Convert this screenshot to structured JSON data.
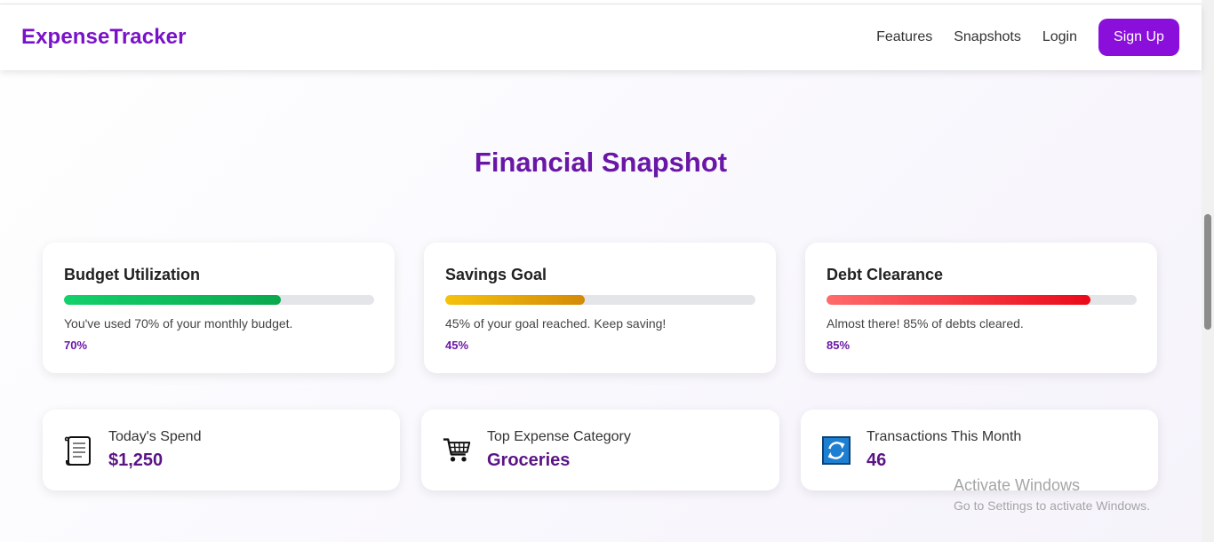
{
  "nav": {
    "logo": "ExpenseTracker",
    "links": [
      "Features",
      "Snapshots",
      "Login"
    ],
    "signup_label": "Sign Up"
  },
  "section": {
    "title": "Financial Snapshot"
  },
  "goals": [
    {
      "title": "Budget Utilization",
      "description": "You've used 70% of your monthly budget.",
      "percent_label": "70%",
      "progress": 0.7,
      "color_start": "#12d16b",
      "color_end": "#0aa84e"
    },
    {
      "title": "Savings Goal",
      "description": "45% of your goal reached. Keep saving!",
      "percent_label": "45%",
      "progress": 0.45,
      "color_start": "#f5c20c",
      "color_end": "#d48a08"
    },
    {
      "title": "Debt Clearance",
      "description": "Almost there! 85% of debts cleared.",
      "percent_label": "85%",
      "progress": 0.85,
      "color_start": "#ff6b6b",
      "color_end": "#ea0a1a"
    }
  ],
  "stats": [
    {
      "label": "Today's Spend",
      "value": "$1,250",
      "icon": "receipt-icon"
    },
    {
      "label": "Top Expense Category",
      "value": "Groceries",
      "icon": "shopping-cart-icon"
    },
    {
      "label": "Transactions This Month",
      "value": "46",
      "icon": "refresh-icon"
    }
  ],
  "watermark": {
    "title": "Activate Windows",
    "subtitle": "Go to Settings to activate Windows."
  },
  "colors": {
    "brand": "#8a0fdb",
    "heading": "#6a16a6",
    "value": "#5a1486"
  }
}
